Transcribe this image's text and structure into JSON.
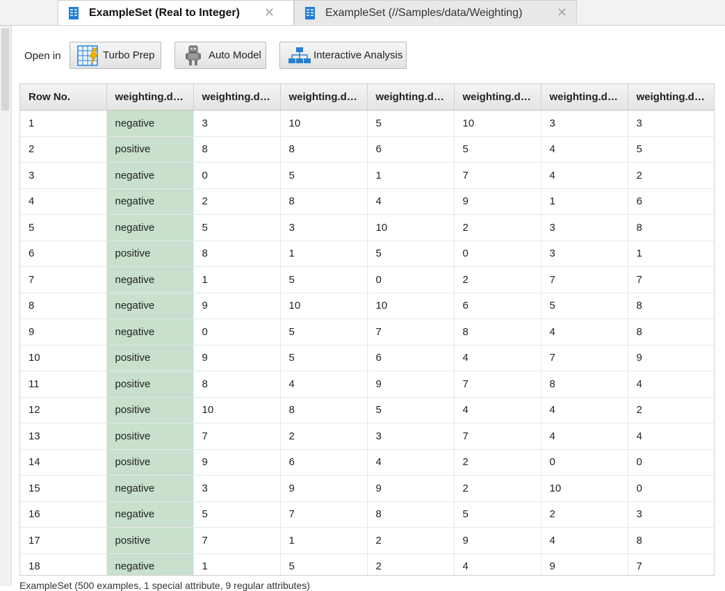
{
  "tabs": [
    {
      "label": "ExampleSet (Real to Integer)",
      "active": true,
      "close": "✕"
    },
    {
      "label": "ExampleSet (//Samples/data/Weighting)",
      "active": false,
      "close": "✕"
    }
  ],
  "toolbar": {
    "open_in_label": "Open in",
    "buttons": [
      {
        "label": "Turbo Prep",
        "icon": "turbo-prep-grid-icon"
      },
      {
        "label": "Auto Model",
        "icon": "robot-icon"
      },
      {
        "label": "Interactive Analysis",
        "icon": "hierarchy-icon"
      }
    ]
  },
  "table": {
    "headers": [
      "Row No.",
      "weighting.da...",
      "weighting.da...",
      "weighting.da...",
      "weighting.da...",
      "weighting.da...",
      "weighting.da...",
      "weighting.da..."
    ],
    "rows": [
      [
        "1",
        "negative",
        "3",
        "10",
        "5",
        "10",
        "3",
        "3"
      ],
      [
        "2",
        "positive",
        "8",
        "8",
        "6",
        "5",
        "4",
        "5"
      ],
      [
        "3",
        "negative",
        "0",
        "5",
        "1",
        "7",
        "4",
        "2"
      ],
      [
        "4",
        "negative",
        "2",
        "8",
        "4",
        "9",
        "1",
        "6"
      ],
      [
        "5",
        "negative",
        "5",
        "3",
        "10",
        "2",
        "3",
        "8"
      ],
      [
        "6",
        "positive",
        "8",
        "1",
        "5",
        "0",
        "3",
        "1"
      ],
      [
        "7",
        "negative",
        "1",
        "5",
        "0",
        "2",
        "7",
        "7"
      ],
      [
        "8",
        "negative",
        "9",
        "10",
        "10",
        "6",
        "5",
        "8"
      ],
      [
        "9",
        "negative",
        "0",
        "5",
        "7",
        "8",
        "4",
        "8"
      ],
      [
        "10",
        "positive",
        "9",
        "5",
        "6",
        "4",
        "7",
        "9"
      ],
      [
        "11",
        "positive",
        "8",
        "4",
        "9",
        "7",
        "8",
        "4"
      ],
      [
        "12",
        "positive",
        "10",
        "8",
        "5",
        "4",
        "4",
        "2"
      ],
      [
        "13",
        "positive",
        "7",
        "2",
        "3",
        "7",
        "4",
        "4"
      ],
      [
        "14",
        "positive",
        "9",
        "6",
        "4",
        "2",
        "0",
        "0"
      ],
      [
        "15",
        "negative",
        "3",
        "9",
        "9",
        "2",
        "10",
        "0"
      ],
      [
        "16",
        "negative",
        "5",
        "7",
        "8",
        "5",
        "2",
        "3"
      ],
      [
        "17",
        "positive",
        "7",
        "1",
        "2",
        "9",
        "4",
        "8"
      ],
      [
        "18",
        "negative",
        "1",
        "5",
        "2",
        "4",
        "9",
        "7"
      ]
    ]
  },
  "status": "ExampleSet (500 examples, 1 special attribute, 9 regular attributes)",
  "colors": {
    "label_column_bg": "#c8e0cc",
    "tab_icon_blue": "#1f7fd6"
  }
}
